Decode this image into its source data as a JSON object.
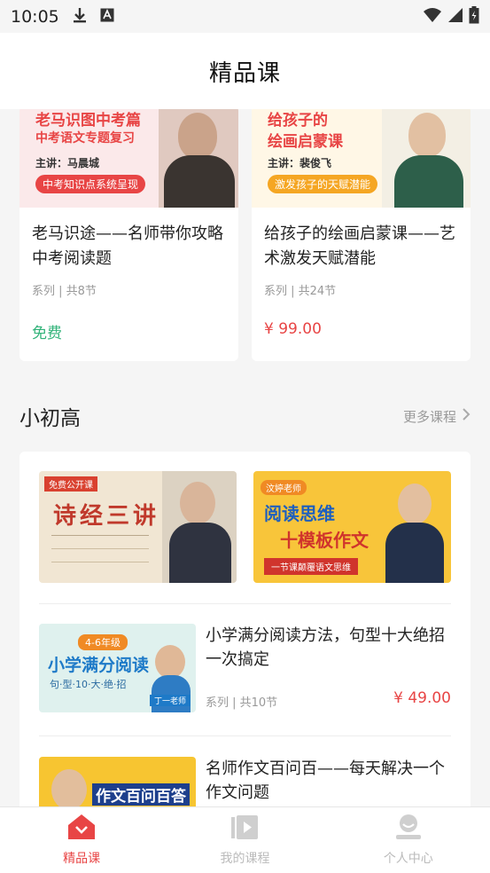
{
  "status_bar": {
    "time": "10:05"
  },
  "header": {
    "title": "精品课"
  },
  "top_cards": [
    {
      "banner_headline_1": "老马识图中考篇",
      "banner_headline_2": "中考语文专题复习",
      "banner_speaker": "主讲：马晨城",
      "banner_tagline": "中考知识点系统呈现",
      "title": "老马识途——名师带你攻略中考阅读题",
      "meta": "系列 | 共8节",
      "price": "免费"
    },
    {
      "banner_headline_1": "给孩子的",
      "banner_headline_2": "绘画启蒙课",
      "banner_speaker": "主讲：裴俊飞",
      "banner_tagline": "激发孩子的天赋潜能",
      "title": "给孩子的绘画启蒙课——艺术激发天赋潜能",
      "meta": "系列 | 共24节",
      "price": "¥ 99.00"
    }
  ],
  "section": {
    "title": "小初高",
    "more_label": "更多课程"
  },
  "banners": {
    "left": {
      "tag": "免费公开课",
      "headline": "诗经三讲"
    },
    "right": {
      "tag": "汶婷老师",
      "headline_1": "阅读思维",
      "headline_2": "十模板作文",
      "tagline": "一节课颠覆语文思维"
    }
  },
  "courses": [
    {
      "thumb_grade": "4-6年级",
      "thumb_headline": "小学满分阅读",
      "thumb_sub": "句·型·10·大·绝·招",
      "thumb_teacher": "丁一老师",
      "title": "小学满分阅读方法，句型十大绝招一次搞定",
      "meta": "系列 | 共10节",
      "price": "¥ 49.00"
    },
    {
      "thumb_headline": "作文百问百答",
      "title": "名师作文百问百——每天解决一个作文问题"
    }
  ],
  "tabbar": [
    {
      "label": "精品课",
      "icon": "home-icon",
      "active": true
    },
    {
      "label": "我的课程",
      "icon": "play-icon",
      "active": false
    },
    {
      "label": "个人中心",
      "icon": "user-icon",
      "active": false
    }
  ],
  "colors": {
    "accent": "#e84545",
    "free": "#33b37a"
  }
}
